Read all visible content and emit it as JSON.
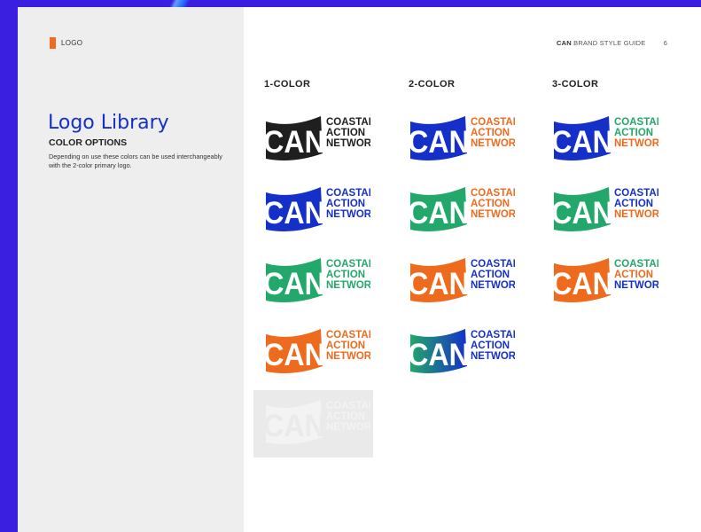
{
  "section_label": "LOGO",
  "title": "Logo Library",
  "subtitle": "COLOR OPTIONS",
  "description": "Depending on use these colors can be used interchangeably with the 2-color primary logo.",
  "header": {
    "brand": "CAN",
    "guide": "BRAND STYLE GUIDE",
    "page_number": "6"
  },
  "colors": {
    "black": "#1f1f1f",
    "blue": "#1530c8",
    "green": "#22a86a",
    "orange": "#ee6a1c",
    "ghost": "#f3f3f3"
  },
  "logo_text": {
    "mark": "CAN",
    "line1": "COASTAL",
    "line2": "ACTION",
    "line3": "NETWORK"
  },
  "columns": [
    {
      "heading": "1-COLOR",
      "logos": [
        {
          "flag": "#1f1f1f",
          "text": "#1f1f1f"
        },
        {
          "flag": "#1530c8",
          "text": "#1530c8"
        },
        {
          "flag": "#22a86a",
          "text": "#22a86a"
        },
        {
          "flag": "#ee6a1c",
          "text": "#ee6a1c"
        },
        {
          "flag": "#f3f3f3",
          "text": "#f3f3f3"
        }
      ]
    },
    {
      "heading": "2-COLOR",
      "logos": [
        {
          "flag": "#1530c8",
          "text": "#ee6a1c"
        },
        {
          "flag": "#22a86a",
          "text": "#ee6a1c"
        },
        {
          "flag": "#ee6a1c",
          "text": "#1530c8"
        },
        {
          "flag": "#22a86a",
          "gradient_to": "#1530c8",
          "text": "#1530c8"
        }
      ]
    },
    {
      "heading": "3-COLOR",
      "logos": [
        {
          "flag": "#1530c8",
          "text": [
            "#22a86a",
            "#22a86a",
            "#ee6a1c"
          ]
        },
        {
          "flag": "#22a86a",
          "text": [
            "#1530c8",
            "#1530c8",
            "#ee6a1c"
          ]
        },
        {
          "flag": "#ee6a1c",
          "text": [
            "#22a86a",
            "#ee6a1c",
            "#1530c8"
          ]
        }
      ]
    }
  ]
}
